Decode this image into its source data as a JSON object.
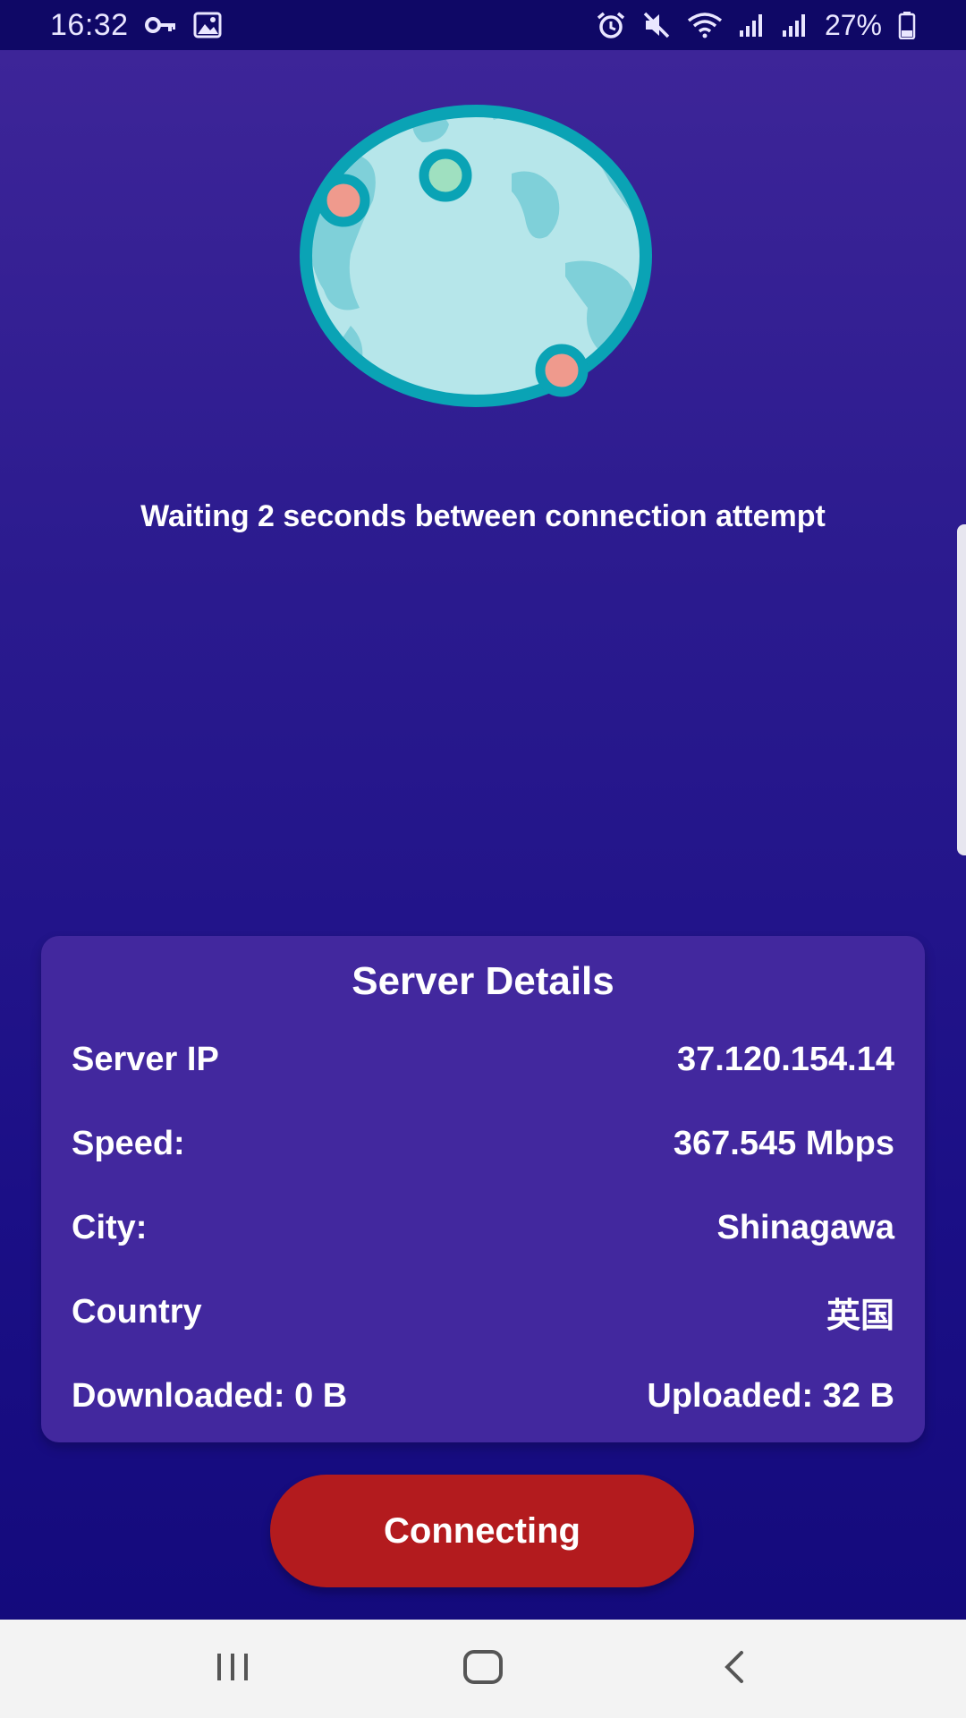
{
  "status_bar": {
    "time": "16:32",
    "battery": "27%",
    "icons_left": [
      "key-icon",
      "image-icon"
    ],
    "icons_right": [
      "alarm-icon",
      "mute-icon",
      "wifi-icon",
      "signal-icon",
      "signal-icon",
      "battery-icon"
    ]
  },
  "status_message": "Waiting 2 seconds between connection attempt",
  "server_details": {
    "title": "Server Details",
    "server_ip_label": "Server IP",
    "server_ip_value": "37.120.154.14",
    "speed_label": "Speed:",
    "speed_value": "367.545 Mbps",
    "city_label": "City:",
    "city_value": "Shinagawa",
    "country_label": "Country",
    "country_value": "英国",
    "downloaded": "Downloaded: 0 B",
    "uploaded": "Uploaded: 32 B"
  },
  "connect_button_label": "Connecting",
  "nav_bar": {
    "icons": [
      "recent-apps-icon",
      "home-icon",
      "back-icon"
    ]
  },
  "colors": {
    "background_top": "#3f2699",
    "background_bottom": "#12097a",
    "card": "#42289e",
    "button": "#b31b1e",
    "globe_ocean": "#b6e6ea",
    "globe_land": "#7fd0d9",
    "globe_border": "#0aa3b5",
    "pin_red": "#ef9a8d",
    "pin_green": "#9fe0c0"
  }
}
